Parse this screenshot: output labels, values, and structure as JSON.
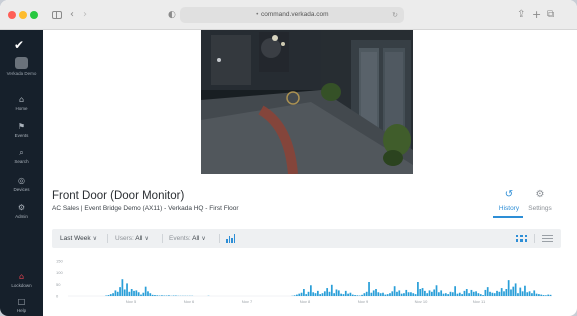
{
  "browser": {
    "url": "command.verkada.com"
  },
  "sidebar": {
    "org_name": "Verkada Demo",
    "items": [
      {
        "label": "Home",
        "icon": "home-icon"
      },
      {
        "label": "Events",
        "icon": "bell-icon"
      },
      {
        "label": "Search",
        "icon": "search-icon"
      },
      {
        "label": "Devices",
        "icon": "devices-icon"
      },
      {
        "label": "Admin",
        "icon": "admin-icon"
      }
    ],
    "lockdown": "Lockdown",
    "help": "Help"
  },
  "header": {
    "title": "Front Door (Door Monitor)",
    "subtitle": "AC Sales | Event Bridge Demo (AX11) - Verkada HQ - First Floor",
    "tabs": [
      {
        "label": "History",
        "icon": "history-icon",
        "active": true
      },
      {
        "label": "Settings",
        "icon": "gear-icon",
        "active": false
      }
    ]
  },
  "filters": {
    "range": "Last Week",
    "users_label": "Users:",
    "users_value": "All",
    "events_label": "Events:",
    "events_value": "All"
  },
  "colors": {
    "accent": "#2d8ed6",
    "sidebar_bg": "#16202b",
    "bar": "#2a9fd8",
    "lockdown": "#e0424f"
  },
  "chart_data": {
    "type": "bar",
    "ylim": [
      0,
      150
    ],
    "y_ticks": [
      "150",
      "100",
      "50",
      "0"
    ],
    "x_ticks": [
      "Nov 5",
      "Nov 6",
      "Nov 7",
      "Nov 8",
      "Nov 9",
      "Nov 10",
      "Nov 11"
    ],
    "series": [
      {
        "values": [
          0,
          0,
          0,
          0,
          0,
          0,
          0,
          0,
          0,
          0,
          0,
          0,
          0,
          0,
          0,
          0,
          2,
          4,
          8,
          12,
          24,
          18,
          38,
          72,
          28,
          54,
          18,
          30,
          22,
          24,
          16,
          6,
          14,
          40,
          20,
          12,
          5,
          4,
          3,
          2,
          3,
          2,
          2,
          3,
          1,
          2,
          2,
          1,
          1,
          1,
          1,
          1,
          1,
          1,
          0,
          0,
          0,
          0,
          0,
          0,
          1,
          0,
          0,
          0,
          0,
          0,
          0,
          0,
          0,
          0,
          0,
          0,
          0,
          0,
          0,
          0,
          0,
          0,
          0,
          0,
          0,
          0,
          0,
          0,
          0,
          0,
          0,
          0,
          0,
          0,
          0,
          0,
          0,
          0,
          0,
          0,
          1,
          3,
          6,
          10,
          14,
          30,
          8,
          18,
          46,
          16,
          12,
          22,
          8,
          12,
          20,
          34,
          18,
          48,
          12,
          28,
          24,
          10,
          8,
          22,
          10,
          14,
          6,
          4,
          3,
          2,
          5,
          12,
          18,
          60,
          14,
          24,
          30,
          16,
          12,
          14,
          6,
          8,
          12,
          20,
          42,
          18,
          24,
          10,
          12,
          26,
          16,
          16,
          12,
          8,
          60,
          30,
          34,
          22,
          12,
          24,
          18,
          28,
          46,
          16,
          24,
          10,
          12,
          8,
          18,
          16,
          42,
          10,
          14,
          8,
          22,
          30,
          12,
          26,
          18,
          20,
          12,
          8,
          4,
          26,
          38,
          18,
          14,
          12,
          22,
          18,
          34,
          20,
          30,
          68,
          28,
          40,
          54,
          12,
          36,
          20,
          44,
          16,
          20,
          12,
          24,
          10,
          8,
          6,
          4,
          3,
          6,
          5
        ]
      }
    ]
  }
}
